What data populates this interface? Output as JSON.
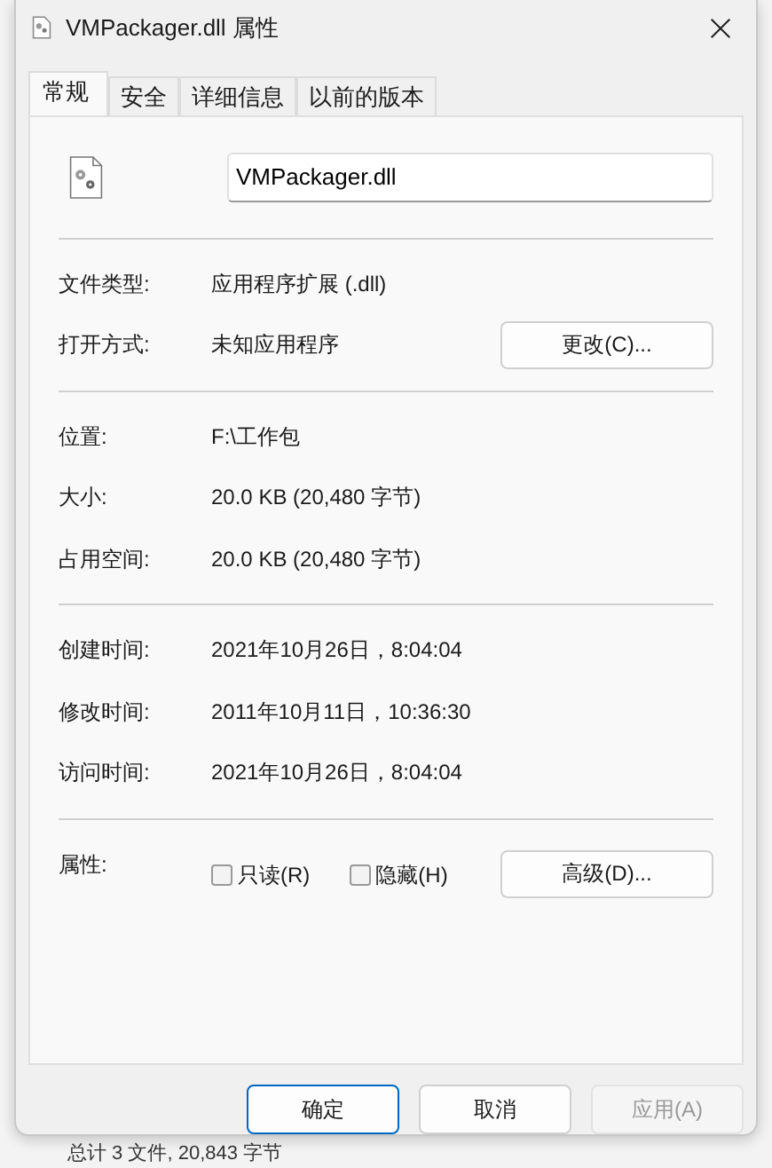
{
  "window": {
    "title": "VMPackager.dll 属性"
  },
  "tabs": [
    {
      "label": "常规",
      "selected": true
    },
    {
      "label": "安全",
      "selected": false
    },
    {
      "label": "详细信息",
      "selected": false
    },
    {
      "label": "以前的版本",
      "selected": false
    }
  ],
  "file_name": "VMPackager.dll",
  "groups": [
    [
      {
        "label": "文件类型:",
        "value": "应用程序扩展 (.dll)"
      },
      {
        "label": "打开方式:",
        "value": "未知应用程序",
        "button": "更改(C)..."
      }
    ],
    [
      {
        "label": "位置:",
        "value": "F:\\工作包"
      },
      {
        "label": "大小:",
        "value": "20.0 KB (20,480 字节)"
      },
      {
        "label": "占用空间:",
        "value": "20.0 KB (20,480 字节)"
      }
    ],
    [
      {
        "label": "创建时间:",
        "value": "2021年10月26日，8:04:04"
      },
      {
        "label": "修改时间:",
        "value": "2011年10月11日，10:36:30"
      },
      {
        "label": "访问时间:",
        "value": "2021年10月26日，8:04:04"
      }
    ]
  ],
  "attributes": {
    "label": "属性:",
    "checkboxes": [
      {
        "label": "只读(R)",
        "checked": false
      },
      {
        "label": "隐藏(H)",
        "checked": false
      }
    ],
    "button": "高级(D)..."
  },
  "buttons": [
    {
      "label": "确定",
      "default": true,
      "disabled": false
    },
    {
      "label": "取消",
      "default": false,
      "disabled": false
    },
    {
      "label": "应用(A)",
      "default": false,
      "disabled": true
    }
  ],
  "background_status": "总计 3 文件, 20,843 字节"
}
